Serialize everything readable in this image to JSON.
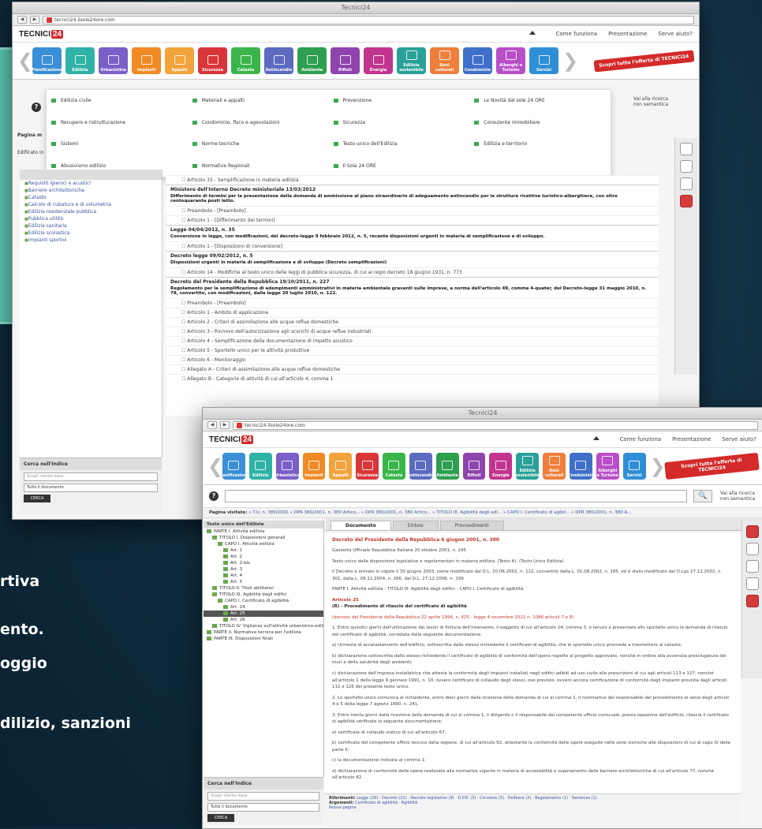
{
  "background": {
    "color": "#0e2a3a",
    "accent": "#5cc7b3"
  },
  "side_text": [
    "rtiva",
    "ento.",
    "oggio",
    "dilizio, sanzioni"
  ],
  "window_back": {
    "title": "Tecnici24",
    "url": "tecnici24.ilsole24ore.com",
    "header_links": [
      "Come funziona",
      "Presentazione",
      "Serve aiuto?"
    ],
    "menu_items": [
      "Edilizia civile",
      "Materiali e appalti",
      "Prevenzione",
      "Le Novità dal sole 24 ORE",
      "Recupero e ristrutturazione",
      "Condominio, fisco e agevolazioni",
      "Sicurezza",
      "Consulente immobiliare",
      "Sistemi",
      "Norme tecniche",
      "Testo unico dell'Edilizia",
      "Edilizia e territorio",
      "Abusivismo edilizio",
      "Normative Regionali",
      "Il Sole 24 ORE",
      ""
    ],
    "left_label": "Pagina m",
    "left_label2": "Edificato in",
    "search_hint": "Vai alla ricerca non semantica",
    "sidebar_items": [
      "Requisiti igienici e acustici",
      "Barriere architettoniche",
      "Catasto",
      "Calcolo di cubatura e di volumetria",
      "Edilizia residenziale pubblica",
      "Pubblica utilità",
      "Edilizia sanitaria",
      "Edilizia scolastica",
      "Impianti sportivi"
    ],
    "documents": [
      {
        "head": "",
        "sub": "",
        "articles": [
          "Articolo 33 - Semplificazione in materia edilizia"
        ]
      },
      {
        "head": "Ministero dell'Interno Decreto ministeriale 13/03/2012",
        "sub": "Differimento di termini per la presentazione della domanda di ammissione al piano straordinario di adeguamento antincendio per le strutture ricettive turistico-alberghiere, con oltre centoquaranta posti letto.",
        "articles": [
          "Preambolo - [Preambolo]",
          "Articolo 1 - [Differimento dei termini]"
        ]
      },
      {
        "head": "Legge 04/04/2012, n. 35",
        "sub": "Conversione in legge, con modificazioni, del decreto-legge 9 febbraio 2012, n. 5, recante disposizioni urgenti in materia di semplificazione e di sviluppo.",
        "articles": [
          "Articolo 1 - [Disposizioni di conversione]"
        ]
      },
      {
        "head": "Decreto legge 09/02/2012, n. 5",
        "sub": "Disposizioni urgenti in materia di semplificazione e di sviluppo (Decreto semplificazioni)",
        "articles": [
          "Articolo 14 - Modifiche al testo unico delle leggi di pubblica sicurezza, di cui al regio decreto 18 giugno 1931, n. 773"
        ]
      },
      {
        "head": "Decreto del Presidente della Repubblica 19/10/2011, n. 227",
        "sub": "Regolamento per la semplificazione di adempimenti amministrativi in materia ambientale gravanti sulle imprese, a norma dell'articolo 49, comma 4-quater, del Decreto-legge 31 maggio 2010, n. 78, convertito, con modificazioni, dalla legge 30 luglio 2010, n. 122.",
        "articles": [
          "Preambolo - [Preambolo]",
          "Articolo 1 - Ambito di applicazione",
          "Articolo 2 - Criteri di assimilazione alle acque reflue domestiche",
          "Articolo 3 - Rinnovo dell'autorizzazione agli scarichi di acque reflue industriali",
          "Articolo 4 - Semplificazione della documentazione di impatto acustico",
          "Articolo 5 - Sportello unico per le attività produttive",
          "Articolo 6 - Monitoraggio",
          "Allegato A - Criteri di assimilazione alle acque reflue domestiche",
          "Allegato B - Categorie di attività di cui all'articolo 4, comma 1"
        ]
      }
    ],
    "bottom_panel": {
      "label": "Cerca nell'Indice",
      "input_placeholder": "Scegli utente dasa",
      "select": "Tutto il documento",
      "button": "CERCA"
    }
  },
  "window_front": {
    "title": "Tecnici24",
    "url": "tecnici24.ilsole24ore.com",
    "header_links": [
      "Come funziona",
      "Presentazione",
      "Serve aiuto?"
    ],
    "search_hint": "Vai alla ricerca non semantica",
    "breadcrumb_label": "Pagina visitate:",
    "breadcrumb_items": [
      "T.U. n. 380/2001",
      "DPR 380/2001, n. 380 Artico...",
      "DPR 380/2001, n. 380 Artico...",
      "TITOLO III. Agibilità degli edi...",
      "CAPO I. Certificato di agibil...",
      "DPR 380/2001, n. 380 A..."
    ],
    "tree_header": "Testo unico dell'Edilizia",
    "tabs": [
      "Documento",
      "Sintesi",
      "Provvedimenti"
    ],
    "tree_nodes": [
      {
        "label": "PARTE I. Attività edilizia",
        "indent": 0
      },
      {
        "label": "TITOLO I. Disposizioni generali",
        "indent": 1
      },
      {
        "label": "CAPO I. Attività edilizia",
        "indent": 2
      },
      {
        "label": "Art. 1",
        "indent": 3
      },
      {
        "label": "Art. 2",
        "indent": 3
      },
      {
        "label": "Art. 2-bis",
        "indent": 3
      },
      {
        "label": "Art. 3",
        "indent": 3
      },
      {
        "label": "Art. 4",
        "indent": 3
      },
      {
        "label": "Art. 5",
        "indent": 3
      },
      {
        "label": "TITOLO II. Titoli abilitativi",
        "indent": 1
      },
      {
        "label": "TITOLO III. Agibilità degli edifici",
        "indent": 1
      },
      {
        "label": "CAPO I. Certificato di agibilità",
        "indent": 2
      },
      {
        "label": "Art. 24",
        "indent": 3
      },
      {
        "label": "Art. 25",
        "indent": 3,
        "selected": true
      },
      {
        "label": "Art. 26",
        "indent": 3
      },
      {
        "label": "TITOLO IV. Vigilanza sull'attività urbanistico-ediliz",
        "indent": 1
      },
      {
        "label": "PARTE II. Normativa tecnica per l'edilizia",
        "indent": 0
      },
      {
        "label": "PARTE III. Disposizioni finali",
        "indent": 0
      }
    ],
    "article_title": "Decreto del Presidente della Repubblica 6 giugno 2001, n. 380",
    "article_gazette": "Gazzetta Ufficiale Repubblica Italiana 20 ottobre 2001, n. 245",
    "article_intro": "Testo unico delle disposizioni legislative e regolamentari in materia edilizia. (Testo A). (Testo Unico Edilizia)",
    "article_note": "Il Decreto è entrato in vigore il 30 giugno 2003, come modificato dal D.L. 20.06.2002, n. 122, convertito dalla L. 01.08.2002, n. 185, ed è stato modificato dal D.Lgs 27.12.2002, n. 301, dalla L. 09.11.2004, n. 266, dal D.L. 27.12.2006, n. 299",
    "article_path": "PARTE I. Attività edilizia - TITOLO III. Agibilità degli edifici - CAPO I. Certificato di agibilità",
    "article_num": "Articolo 25",
    "article_heading": "(R) - Procedimento di rilascio del certificato di agibilità",
    "article_paras": [
      "(decreto del Presidente della Repubblica 22 aprile 1994, n. 425 - legge 4 novembre 2011 n. 1086 articoli 7 e 8)",
      "1. Entro quindici giorni dall'ultimazione dei lavori di finitura dell'intervento, il soggetto di cui all'articolo 24, comma 3, è tenuto a presentare allo sportello unico la domanda di rilascio del certificato di agibilità, corredata dalla seguente documentazione:",
      "a) richiesta di accatastamento dell'edificio, sottoscritta dallo stesso richiedente il certificato di agibilità, che lo sportello unico provvede a trasmettere al catasto;",
      "b) dichiarazione sottoscritta dallo stesso richiedente il certificato di agibilità di conformità dell'opera rispetto al progetto approvato, nonché in ordine alla avvenuta prosciugatura dei muri e della salubrità degli ambienti;",
      "c) dichiarazione dell'impresa installatrice che attesta la conformità degli impianti installati negli edifici adibiti ad uso civile alle prescrizioni di cui agli articoli 113 e 127, nonché all'articolo 1 della legge 9 gennaio 1991, n. 10, ovvero certificato di collaudo degli stessi, ove previsto, ovvero ancora certificazione di conformità degli impianti prevista dagli articoli 111 e 126 del presente testo unico.",
      "2. Lo sportello unico comunica al richiedente, entro dieci giorni dalla ricezione della domanda di cui al comma 1, il nominativo del responsabile del procedimento ai sensi degli articoli 4 e 5 della legge 7 agosto 1990, n. 241.",
      "3. Entro trenta giorni dalla ricezione della domanda di cui al comma 1, il dirigente o il responsabile del competente ufficio comunale, previa ispezione dell'edificio, rilascia il certificato di agibilità verificata la seguente documentazione:",
      "a) certificato di collaudo statico di cui all'articolo 67;",
      "b) certificato del competente ufficio tecnico della regione, di cui all'articolo 62, attestante la conformità delle opere eseguite nelle zone sismiche alle disposizioni di cui al capo IV della parte II;",
      "c) la documentazione indicata al comma 1;",
      "d) dichiarazione di conformità delle opere realizzate alla normativa vigente in materia di accessibilità e superamento delle barriere architettoniche di cui all'articolo 77, nonché all'articolo 82."
    ],
    "footer_label": "Riferimenti:",
    "footer_text": "Legge (26) · Decreto (21) · Decreto legislativo (9) · D.P.R. (3) · Circolare (3) · Delibera (2) · Regolamento (1) · Sentenza (1)",
    "footer_label2": "Argomenti:",
    "footer_text2": "Certificato di agibilità · Agibilità",
    "footer_link": "Nuova pagina",
    "bottom_panel": {
      "label": "Cerca nell'Indice",
      "input_placeholder": "Scegli utente dasa",
      "select": "Tutto il documento",
      "button": "CERCA"
    }
  },
  "tiles": [
    {
      "label": "Pianificazione",
      "color": "#3a8fd6"
    },
    {
      "label": "Edilizia",
      "color": "#2fb2a6"
    },
    {
      "label": "Urbanistica",
      "color": "#7a5fc7"
    },
    {
      "label": "Impianti",
      "color": "#f08a24"
    },
    {
      "label": "Appalti",
      "color": "#f2a33b"
    },
    {
      "label": "Sicurezza",
      "color": "#d9363a"
    },
    {
      "label": "Catasto",
      "color": "#3ab54a"
    },
    {
      "label": "Antincendio",
      "color": "#5c6bc0"
    },
    {
      "label": "Ambiente",
      "color": "#2e9e4f"
    },
    {
      "label": "Rifiuti",
      "color": "#8e44ad"
    },
    {
      "label": "Energia",
      "color": "#c2358f"
    },
    {
      "label": "Edilizia sostenibile",
      "color": "#2aa198"
    },
    {
      "label": "Beni culturali",
      "color": "#f07f3c"
    },
    {
      "label": "Condominio",
      "color": "#3f6fc9"
    },
    {
      "label": "Alberghi e Turismo",
      "color": "#b84fc8"
    },
    {
      "label": "Servizi",
      "color": "#2f8fd6"
    }
  ],
  "promo_text": "Scopri tutta l'offerta di TECNICI24"
}
